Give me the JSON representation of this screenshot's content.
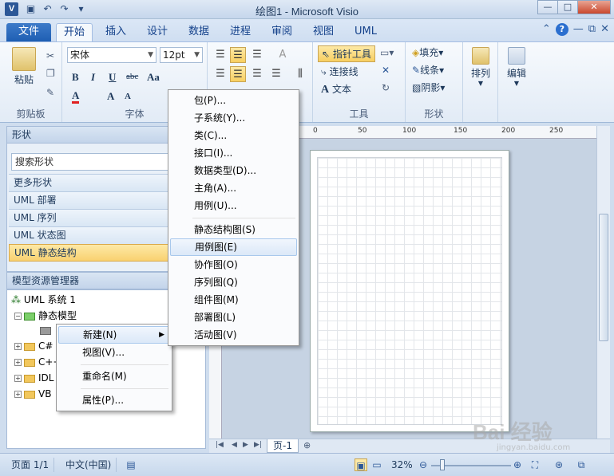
{
  "window": {
    "title": "绘图1 - Microsoft Visio",
    "app_icon": "V",
    "qat_icons": [
      "save-icon",
      "undo-icon",
      "redo-icon",
      "customize-icon"
    ],
    "controls": [
      "minimize",
      "maximize",
      "close"
    ]
  },
  "ribbon": {
    "tabs": [
      "文件",
      "开始",
      "插入",
      "设计",
      "数据",
      "进程",
      "审阅",
      "视图",
      "UML"
    ],
    "active_tab": "开始",
    "clipboard": {
      "paste_label": "粘贴",
      "group_label": "剪贴板"
    },
    "font": {
      "family": "宋体",
      "size": "12pt",
      "bold": "B",
      "italic": "I",
      "underline": "U",
      "strike": "abc",
      "case": "Aa",
      "color_letter": "A",
      "grow": "A",
      "shrink": "A",
      "group_label": "字体"
    },
    "tools": {
      "pointer": "指针工具",
      "connector": "连接线",
      "text": "文本",
      "group_label": "工具"
    },
    "shape_style": {
      "fill": "填充",
      "line": "线条",
      "shadow": "阴影",
      "group_label": "形状"
    },
    "arrange_label": "排列",
    "edit_label": "编辑"
  },
  "shapes_panel": {
    "header": "形状",
    "search_placeholder": "搜索形状",
    "stencils": [
      "更多形状",
      "UML 部署",
      "UML 序列",
      "UML 状态图",
      "UML 静态结构"
    ],
    "selected_stencil": "UML 静态结构"
  },
  "model_explorer": {
    "header": "模型资源管理器",
    "root": "UML 系统 1",
    "static_model": "静态模型",
    "packages": [
      "C#",
      "C++",
      "IDL",
      "VB"
    ]
  },
  "context_menu": {
    "items": [
      "新建(N)",
      "视图(V)...",
      "重命名(M)",
      "属性(P)..."
    ],
    "hover": "新建(N)"
  },
  "submenu": {
    "group1": [
      "包(P)...",
      "子系统(Y)...",
      "类(C)...",
      "接口(I)...",
      "数据类型(D)...",
      "主角(A)...",
      "用例(U)..."
    ],
    "group2": [
      "静态结构图(S)",
      "用例图(E)",
      "协作图(O)",
      "序列图(Q)",
      "组件图(M)",
      "部署图(L)",
      "活动图(V)"
    ],
    "hover": "用例图(E)"
  },
  "ruler": {
    "ticks": [
      "0",
      "50",
      "100",
      "150",
      "200",
      "250"
    ]
  },
  "page_tabs": {
    "current": "页-1"
  },
  "statusbar": {
    "page": "页面 1/1",
    "language": "中文(中国)",
    "zoom": "32%"
  },
  "watermark": {
    "text": "Bai 经验",
    "sub": "jingyan.baidu.com"
  }
}
